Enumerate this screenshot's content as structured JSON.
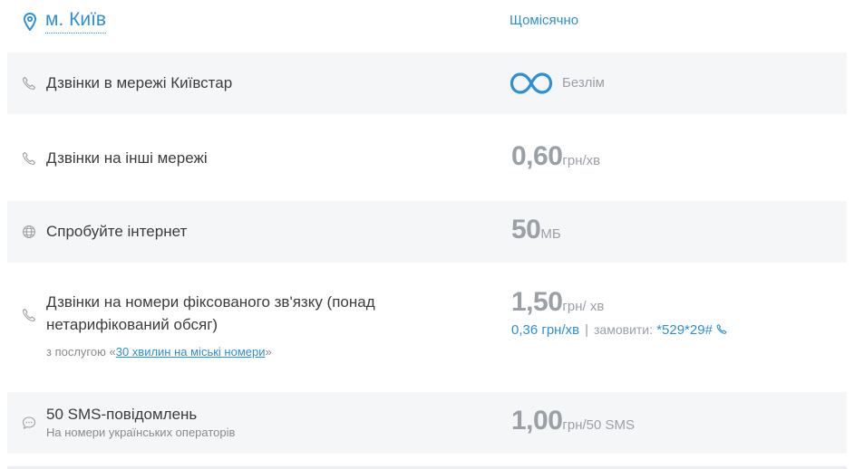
{
  "header": {
    "city": "м. Київ",
    "period": "Щомісячно"
  },
  "rows": [
    {
      "title": "Дзвінки в мережі Київстар",
      "value_label": "Безлім",
      "icon": "phone-icon"
    },
    {
      "title": "Дзвінки на інші мережі",
      "value": "0,60",
      "unit": "грн/хв",
      "icon": "phone-icon"
    },
    {
      "title": "Спробуйте інтернет",
      "value": "50",
      "unit": "МБ",
      "icon": "globe-icon"
    },
    {
      "title_line1": "Дзвінки на номери фіксованого зв'язку (понад",
      "title_line2": "нетарифікований обсяг)",
      "sub_prefix": "з послугою «",
      "sub_link": "30 хвилин на міські номери",
      "sub_suffix": "»",
      "value": "1,50",
      "unit": "грн/ хв",
      "alt_price": "0,36 грн/хв",
      "alt_sep": "|",
      "order_label": "замовити:",
      "order_code": "*529*29#",
      "icon": "phone-icon"
    },
    {
      "title": "50 SMS-повідомлень",
      "sub": "На номери українських операторів",
      "value": "1,00",
      "unit": "грн/50 SMS",
      "icon": "chat-bubble-icon"
    }
  ],
  "colors": {
    "accent": "#2d8fd5",
    "muted": "#9aa0a6",
    "row_bg": "#f5f6f8"
  }
}
